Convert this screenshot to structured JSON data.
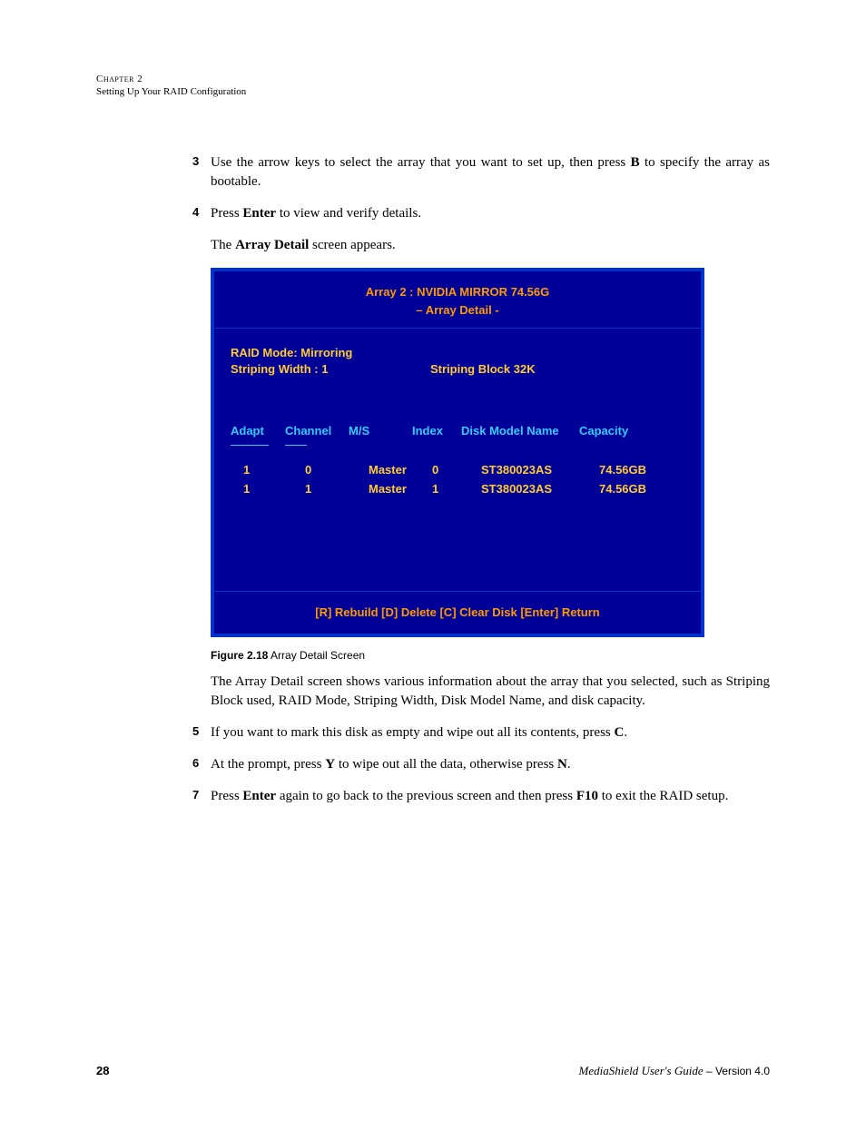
{
  "header": {
    "chapter": "Chapter 2",
    "title": "Setting Up Your RAID Configuration"
  },
  "steps": {
    "s3": {
      "num": "3",
      "pre": "Use the arrow keys to select the array that you want to set up, then press ",
      "key": "B",
      "post": " to specify the array as bootable."
    },
    "s4": {
      "num": "4",
      "pre": "Press ",
      "key": "Enter",
      "post": " to view and verify details."
    },
    "s4b": {
      "pre": "The ",
      "bold": "Array Detail",
      "post": " screen appears."
    },
    "explain": "The Array Detail screen shows various information about the array that you selected, such as Striping Block used, RAID Mode, Striping Width, Disk Model Name, and disk capacity.",
    "s5": {
      "num": "5",
      "pre": "If you want to mark this disk as empty and wipe out all its contents, press ",
      "key": "C",
      "post": "."
    },
    "s6": {
      "num": "6",
      "pre": "At the prompt, press ",
      "key1": "Y",
      "mid": " to wipe out all the data, otherwise press ",
      "key2": "N",
      "post": "."
    },
    "s7": {
      "num": "7",
      "pre": "Press ",
      "key1": "Enter",
      "mid": " again to go back to the previous screen and then press ",
      "key2": "F10",
      "post": " to exit the RAID setup."
    }
  },
  "bios": {
    "title": "Array 2  :  NVIDIA MIRROR 74.56G",
    "subtitle": "–  Array   Detail  -",
    "raid_mode": "RAID Mode:  Mirroring",
    "striping_width": "Striping Width :  1",
    "striping_block": "Striping Block 32K",
    "headers": {
      "adapt": "Adapt",
      "channel": "Channel",
      "ms": "M/S",
      "index": "Index",
      "model": "Disk Model Name",
      "capacity": "Capacity"
    },
    "rows": [
      {
        "adapt": "1",
        "channel": "0",
        "ms": "Master",
        "index": "0",
        "model": "ST380023AS",
        "capacity": "74.56GB"
      },
      {
        "adapt": "1",
        "channel": "1",
        "ms": "Master",
        "index": "1",
        "model": "ST380023AS",
        "capacity": "74.56GB"
      }
    ],
    "footer": "[R] Rebuild   [D] Delete   [C] Clear Disk   [Enter] Return"
  },
  "figure": {
    "label": "Figure 2.18",
    "caption": "   Array Detail Screen"
  },
  "footer": {
    "page": "28",
    "guide": "MediaShield User's Guide",
    "version": " – Version 4.0"
  }
}
